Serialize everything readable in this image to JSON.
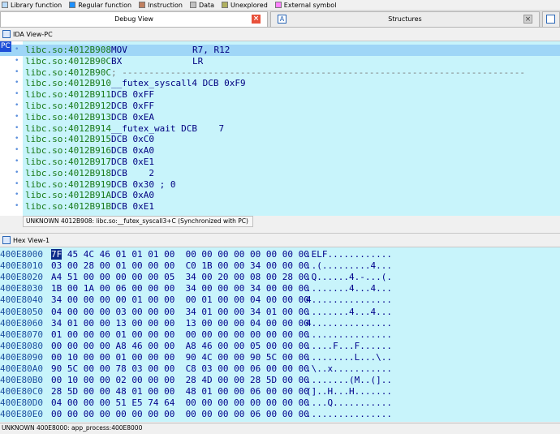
{
  "legend": [
    {
      "label": "Library function",
      "color": "#b9dcfb"
    },
    {
      "label": "Regular function",
      "color": "#1e90ff"
    },
    {
      "label": "Instruction",
      "color": "#c08060"
    },
    {
      "label": "Data",
      "color": "#c0c0c0"
    },
    {
      "label": "Unexplored",
      "color": "#b0b060"
    },
    {
      "label": "External symbol",
      "color": "#ff80ff"
    }
  ],
  "tabs": {
    "debug": {
      "label": "Debug View",
      "close": "×"
    },
    "structures": {
      "label": "Structures",
      "icon": "A",
      "close": "×"
    }
  },
  "ida": {
    "header": "IDA View-PC",
    "pc_marker": "PC",
    "lines": [
      {
        "addr": "libc.so:4012B908",
        "ins": "MOV",
        "op": "R7, R12"
      },
      {
        "addr": "libc.so:4012B90C",
        "ins": "BX",
        "op": "LR"
      },
      {
        "addr": "libc.so:4012B90C",
        "ins": "; ---------------------------------------------------------------------------",
        "op": ""
      },
      {
        "addr": "libc.so:4012B910",
        "ins": "__futex_syscall4 DCB 0xF9",
        "op": ""
      },
      {
        "addr": "libc.so:4012B911",
        "ins": "DCB 0xFF",
        "op": ""
      },
      {
        "addr": "libc.so:4012B912",
        "ins": "DCB 0xFF",
        "op": ""
      },
      {
        "addr": "libc.so:4012B913",
        "ins": "DCB 0xEA",
        "op": ""
      },
      {
        "addr": "libc.so:4012B914",
        "ins": "__futex_wait DCB    7",
        "op": ""
      },
      {
        "addr": "libc.so:4012B915",
        "ins": "DCB 0xC0",
        "op": ""
      },
      {
        "addr": "libc.so:4012B916",
        "ins": "DCB 0xA0",
        "op": ""
      },
      {
        "addr": "libc.so:4012B917",
        "ins": "DCB 0xE1",
        "op": ""
      },
      {
        "addr": "libc.so:4012B918",
        "ins": "DCB    2",
        "op": ""
      },
      {
        "addr": "libc.so:4012B919",
        "ins": "DCB 0x30 ; 0",
        "op": ""
      },
      {
        "addr": "libc.so:4012B91A",
        "ins": "DCB 0xA0",
        "op": ""
      },
      {
        "addr": "libc.so:4012B91B",
        "ins": "DCB 0xE1",
        "op": ""
      }
    ],
    "status": "UNKNOWN 4012B908: libc.so:__futex_syscall3+C (Synchronized with PC)"
  },
  "hex": {
    "header": "Hex View-1",
    "rows": [
      {
        "addr": "400E8000",
        "bytes": "7F 45 4C 46 01 01 01 00  00 00 00 00 00 00 00 00",
        "ascii": ".ELF............"
      },
      {
        "addr": "400E8010",
        "bytes": "03 00 28 00 01 00 00 00  C0 1B 00 00 34 00 00 00",
        "ascii": "..(.........4..."
      },
      {
        "addr": "400E8020",
        "bytes": "A4 51 00 00 00 00 00 05  34 00 20 00 08 00 28 00",
        "ascii": ".Q......4.-...(."
      },
      {
        "addr": "400E8030",
        "bytes": "1B 00 1A 00 06 00 00 00  34 00 00 00 34 00 00 00",
        "ascii": "........4...4..."
      },
      {
        "addr": "400E8040",
        "bytes": "34 00 00 00 00 01 00 00  00 01 00 00 04 00 00 00",
        "ascii": "4..............."
      },
      {
        "addr": "400E8050",
        "bytes": "04 00 00 00 03 00 00 00  34 01 00 00 34 01 00 00",
        "ascii": "........4...4..."
      },
      {
        "addr": "400E8060",
        "bytes": "34 01 00 00 13 00 00 00  13 00 00 00 04 00 00 00",
        "ascii": "4..............."
      },
      {
        "addr": "400E8070",
        "bytes": "01 00 00 00 01 00 00 00  00 00 00 00 00 00 00 00",
        "ascii": "................"
      },
      {
        "addr": "400E8080",
        "bytes": "00 00 00 00 A8 46 00 00  A8 46 00 00 05 00 00 00",
        "ascii": ".....F...F......"
      },
      {
        "addr": "400E8090",
        "bytes": "00 10 00 00 01 00 00 00  90 4C 00 00 90 5C 00 00",
        "ascii": ".........L...\\.."
      },
      {
        "addr": "400E80A0",
        "bytes": "90 5C 00 00 78 03 00 00  C8 03 00 00 06 00 00 00",
        "ascii": ".\\..x..........."
      },
      {
        "addr": "400E80B0",
        "bytes": "00 10 00 00 02 00 00 00  28 4D 00 00 28 5D 00 00",
        "ascii": "........(M..(].."
      },
      {
        "addr": "400E80C0",
        "bytes": "28 5D 00 00 48 01 00 00  48 01 00 00 06 00 00 00",
        "ascii": "(]..H...H......."
      },
      {
        "addr": "400E80D0",
        "bytes": "04 00 00 00 51 E5 74 64  00 00 00 00 00 00 00 00",
        "ascii": "....Q..........."
      },
      {
        "addr": "400E80E0",
        "bytes": "00 00 00 00 00 00 00 00  00 00 00 00 06 00 00 00",
        "ascii": "................"
      }
    ],
    "status": "UNKNOWN 400E8000: app_process:400E8000"
  }
}
